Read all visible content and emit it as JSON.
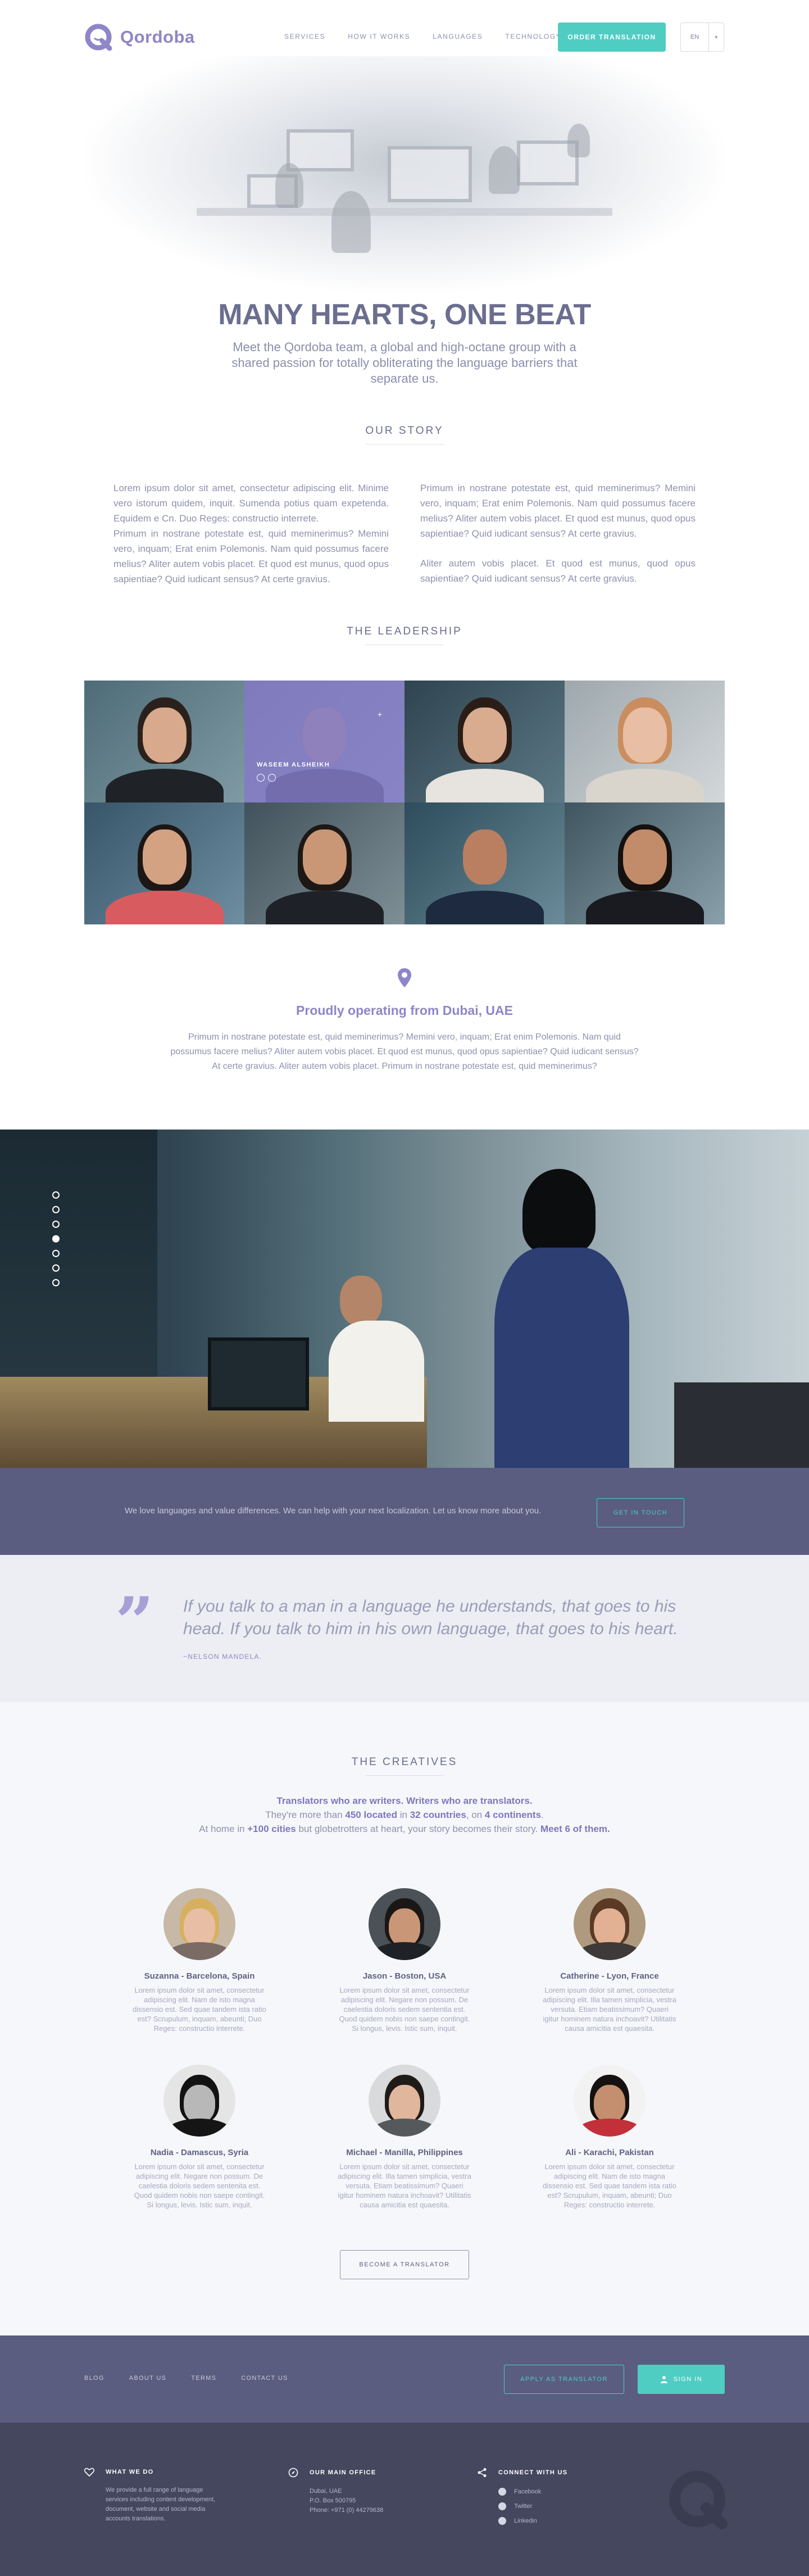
{
  "brand": {
    "name": "Qordoba",
    "accent": "#8e86c7",
    "teal": "#4fcdc3",
    "dark": "#5a5d7f"
  },
  "nav": {
    "links": [
      "SERVICES",
      "HOW IT WORKS",
      "LANGUAGES",
      "TECHNOLOGY"
    ],
    "order_button": "ORDER TRANSLATION",
    "language": "EN",
    "language_caret": "▾"
  },
  "hero": {
    "title": "MANY HEARTS, ONE BEAT",
    "subtitle": "Meet the Qordoba team, a global and high-octane group with a shared passion for totally obliterating the language barriers that separate us."
  },
  "story": {
    "heading": "OUR STORY",
    "left": [
      "Lorem ipsum dolor sit amet, consectetur adipiscing elit. Minime vero istorum quidem, inquit. Sumenda potius quam expetenda. Equidem e Cn. Duo Reges: constructio interrete.",
      "Primum in nostrane potestate est, quid meminerimus? Memini vero, inquam; Erat enim Polemonis. Nam quid possumus facere melius? Aliter autem vobis placet. Et quod est munus, quod opus sapientiae? Quid iudicant sensus? At certe gravius."
    ],
    "right": [
      "Primum in nostrane potestate est, quid meminerimus? Memini vero, inquam; Erat enim Polemonis. Nam quid possumus facere melius? Aliter autem vobis placet. Et quod est munus, quod opus sapientiae? Quid iudicant sensus? At certe gravius.",
      "Aliter autem vobis placet. Et quod est munus, quod opus sapientiae? Quid iudicant sensus? At certe gravius."
    ]
  },
  "leadership": {
    "heading": "THE LEADERSHIP",
    "hovered_name": "WASEEM ALSHEIKH",
    "hovered_plus": "+"
  },
  "location": {
    "title": "Proudly operating from Dubai, UAE",
    "text": "Primum in nostrane potestate est, quid meminerimus? Memini vero, inquam; Erat enim Polemonis. Nam quid possumus facere melius? Aliter autem vobis placet. Et quod est munus, quod opus sapientiae? Quid iudicant sensus? At certe gravius. Aliter autem vobis placet. Primum in nostrane potestate est, quid meminerimus?"
  },
  "cta": {
    "text": "We love languages and value differences. We can help with your next localization. Let us know more about you.",
    "button": "GET IN TOUCH"
  },
  "quote": {
    "mark": "”",
    "text": "If you talk to a man in a language he understands, that goes to his head. If you talk to him in his own language, that goes to his heart.",
    "author": "~NELSON MANDELA."
  },
  "creatives": {
    "heading": "THE CREATIVES",
    "line1": "Translators who are writers. Writers who are translators.",
    "line2_a": "They're more than ",
    "line2_b": "450 located",
    "line2_c": " in ",
    "line2_d": "32 countries",
    "line2_e": ", on ",
    "line2_f": "4 continents",
    "line2_g": ".",
    "line3_a": "At home in ",
    "line3_b": "+100 cities",
    "line3_c": " but globetrotters at heart, your story becomes their story. ",
    "line3_d": "Meet 6 of them.",
    "people": [
      {
        "name": "Suzanna - Barcelona, Spain",
        "desc": "Lorem ipsum dolor sit amet, consectetur adipiscing elit. Nam de isto magna dissensio est. Sed quae tandem ista ratio est? Scrupulum, inquam, abeunti; Duo Reges: constructio interrete."
      },
      {
        "name": "Jason - Boston, USA",
        "desc": "Lorem ipsum dolor sit amet, consectetur adipiscing elit. Negare non possum. De caelestia doloris sedem sententia est. Quod quidem nobis non saepe contingit. Si longus, levis. Istic sum, inquit."
      },
      {
        "name": "Catherine - Lyon, France",
        "desc": "Lorem ipsum dolor sit amet, consectetur adipiscing elit. Illa tamen simplicia, vestra versuta. Etiam beatissimum? Quaeri igitur hominem natura inchoavit? Utilitatis causa amicitia est quaesita."
      },
      {
        "name": "Nadia - Damascus, Syria",
        "desc": "Lorem ipsum dolor sit amet, consectetur adipiscing elit. Negare non possum. De caelestia doloris sedem sentenita est. Quod quidem nobis non saepe contingit. Si longus, levis. Istic sum, inquit."
      },
      {
        "name": "Michael - Manilla, Philippines",
        "desc": "Lorem ipsum dolor sit amet, consectetur adipiscing elit. Illa tamen simplicia, vestra versuta. Etiam beatissimum? Quaeri igitur hominem natura inchoavit? Utilitatis causa amicitia est quaesita."
      },
      {
        "name": "Ali - Karachi, Pakistan",
        "desc": "Lorem ipsum dolor sit amet, consectetur adipiscing elit. Nam de isto magna dissensio est. Sed quae tandem ista ratio est? Scrupulum, inquam, abeunti; Duo Reges: constructio interrete."
      }
    ],
    "button": "BECOME A TRANSLATOR"
  },
  "footer": {
    "links": [
      "BLOG",
      "ABOUT US",
      "TERMS",
      "CONTACT US"
    ],
    "apply": "APPLY AS TRANSLATOR",
    "signin": "SIGN IN",
    "what_title": "WHAT WE DO",
    "what_text": "We provide a full range of language services including content development, document, website and social media accounts translations.",
    "office_title": "OUR MAIN OFFICE",
    "office_lines": [
      "Dubai, UAE",
      "P.O. Box 500795",
      "Phone: +971 (0) 44279638"
    ],
    "social_title": "CONNECT WITH US",
    "social": [
      "Facebook",
      "Twitter",
      "Linkedin"
    ]
  }
}
